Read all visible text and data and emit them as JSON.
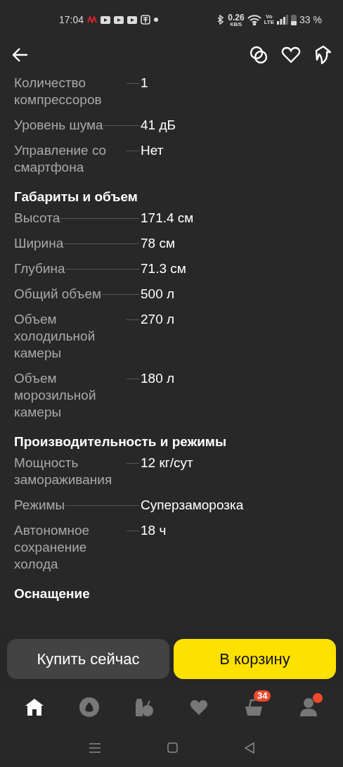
{
  "status_bar": {
    "time": "17:04",
    "speed": "0.26",
    "speed_unit": "KB/S",
    "volte_top": "Vo",
    "volte_bottom": "LTE",
    "battery": "33 %"
  },
  "header": {
    "actions": [
      {
        "kind": "compare"
      },
      {
        "kind": "favorite"
      },
      {
        "kind": "share"
      }
    ]
  },
  "specs": [
    {
      "kind": "row",
      "label": "Количество компрессоров",
      "value": "1"
    },
    {
      "kind": "row",
      "label": "Уровень шума",
      "value": "41 дБ"
    },
    {
      "kind": "row",
      "label": "Управление со смартфона",
      "value": "Нет"
    },
    {
      "kind": "section",
      "title": "Габариты и объем"
    },
    {
      "kind": "row",
      "label": "Высота",
      "value": "171.4 см"
    },
    {
      "kind": "row",
      "label": "Ширина",
      "value": "78 см"
    },
    {
      "kind": "row",
      "label": "Глубина",
      "value": "71.3 см"
    },
    {
      "kind": "row",
      "label": "Общий объем",
      "value": "500 л"
    },
    {
      "kind": "row",
      "label": "Объем холодильной камеры",
      "value": "270 л"
    },
    {
      "kind": "row",
      "label": "Объем морозильной камеры",
      "value": "180 л"
    },
    {
      "kind": "section",
      "title": "Производительность и режимы"
    },
    {
      "kind": "row",
      "label": "Мощность замораживания",
      "value": "12 кг/сут"
    },
    {
      "kind": "row",
      "label": "Режимы",
      "value": "Суперзаморозка"
    },
    {
      "kind": "row",
      "label": "Автономное сохранение холода",
      "value": "18 ч"
    },
    {
      "kind": "section",
      "title": "Оснащение"
    }
  ],
  "buttons": [
    {
      "kind": "secondary",
      "label": "Купить сейчас"
    },
    {
      "kind": "primary",
      "label": "В корзину"
    }
  ],
  "nav": [
    {
      "kind": "home",
      "selected": true
    },
    {
      "kind": "assistant",
      "selected": false
    },
    {
      "kind": "catalog",
      "selected": false
    },
    {
      "kind": "favorites",
      "selected": false
    },
    {
      "kind": "cart",
      "selected": false,
      "badge": "34"
    },
    {
      "kind": "profile",
      "selected": false,
      "dot": true
    }
  ]
}
